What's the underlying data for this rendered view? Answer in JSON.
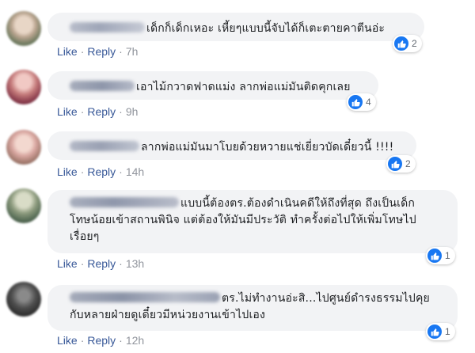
{
  "actions": {
    "like_label": "Like",
    "reply_label": "Reply",
    "separator": "·"
  },
  "colors": {
    "link": "#385898",
    "bubble": "#f2f3f5",
    "timestamp": "#90949c",
    "like_blue": "#1877f2"
  },
  "comments": [
    {
      "text": "เด็กก็เด็กเหอะ เหี้ยๆแบบนี้จับได้ก็เตะตายคาตีนอ่ะ",
      "time": "7h",
      "reaction_icon": "like-icon",
      "reaction_count": "2"
    },
    {
      "text": "เอาไม้กวาดฟาดแม่ง ลากพ่อแม่มันติดคุกเลย",
      "time": "9h",
      "reaction_icon": "like-icon",
      "reaction_count": "4"
    },
    {
      "text": "ลากพ่อแม่มันมาโบยด้วยหวายแช่เยี่ยวบัดเดี๋ยวนี้ !!!!",
      "time": "14h",
      "reaction_icon": "like-icon",
      "reaction_count": "2"
    },
    {
      "text": "แบบนี้ต้องตร.ต้องดำเนินคดีให้ถึงที่สุด ถึงเป็นเด็ก\nโทษน้อยเข้าสถานพินิจ แต่ต้องให้มันมีประวัติ ทำครั้งต่อไปให้เพิ่มโทษไป\nเรื่อยๆ",
      "time": "13h",
      "reaction_icon": "like-icon",
      "reaction_count": "1"
    },
    {
      "text": "ตร.ไม่ทำงานอ่ะสิ...ไปศูนย์ดำรงธรรมไปคุย\nกับหลายฝ่ายดูเดี๋ยวมีหน่วยงานเข้าไปเอง",
      "time": "12h",
      "reaction_icon": "like-icon",
      "reaction_count": "1"
    }
  ]
}
